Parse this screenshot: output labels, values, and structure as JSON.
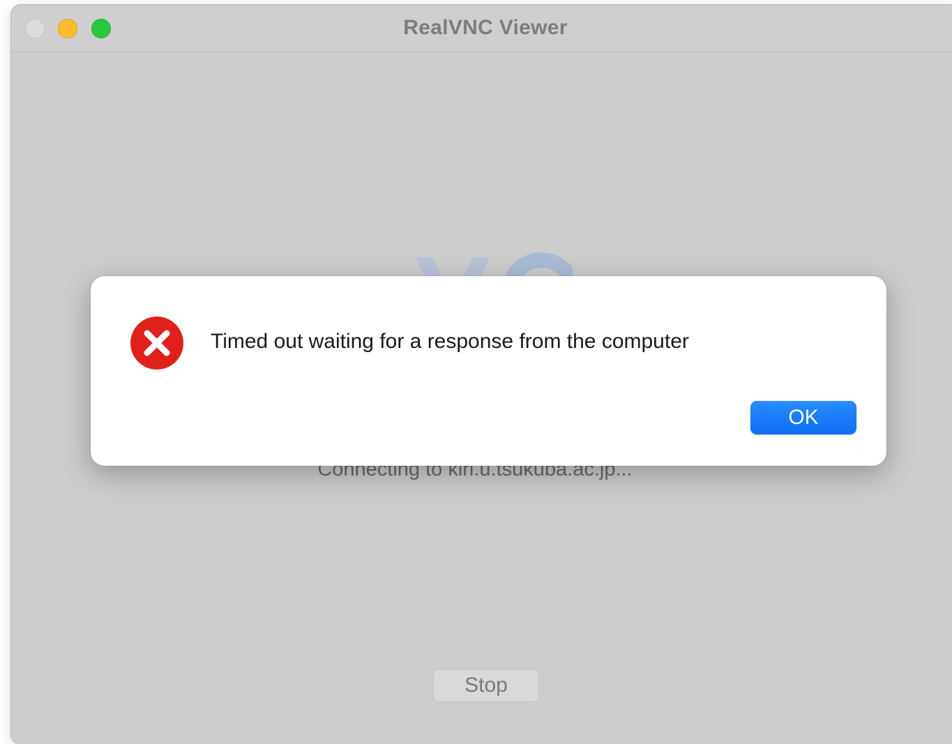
{
  "window": {
    "title": "RealVNC Viewer",
    "status_text": "Connecting to kiri.u.tsukuba.ac.jp...",
    "stop_label": "Stop"
  },
  "dialog": {
    "message": "Timed out waiting for a response from the computer",
    "ok_label": "OK",
    "icon": "error-icon"
  },
  "colors": {
    "accent": "#0a6ff0",
    "error": "#e0201b",
    "traffic_close": "#dcdcdc",
    "traffic_minimize": "#febc2e",
    "traffic_zoom": "#28c840"
  }
}
